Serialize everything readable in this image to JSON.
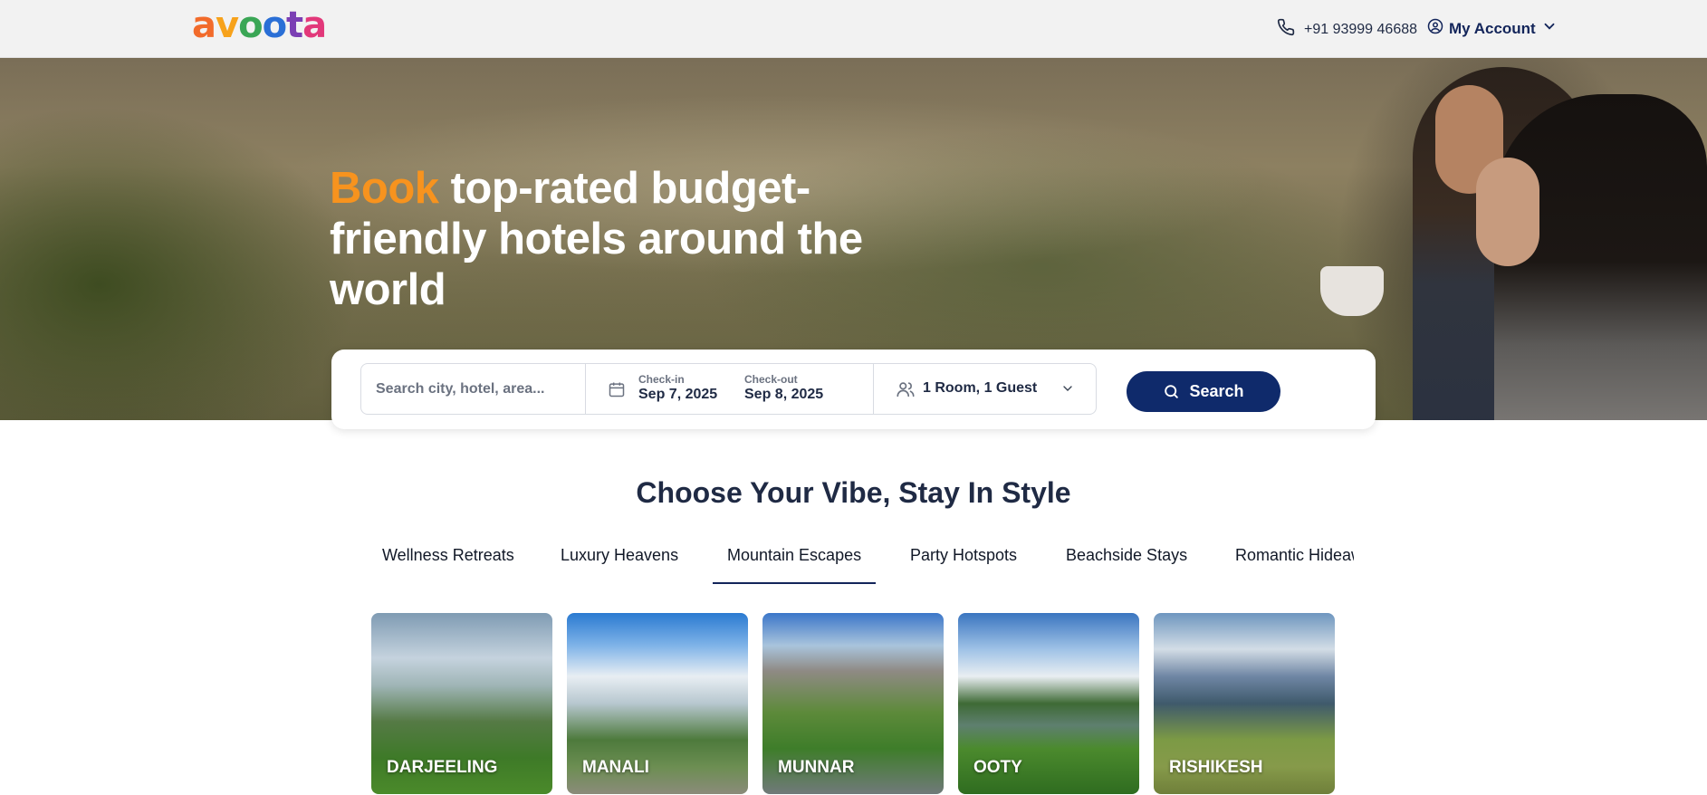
{
  "header": {
    "logo_letters": [
      {
        "char": "a",
        "color": "#f26b2b"
      },
      {
        "char": "v",
        "color": "#f7a21b"
      },
      {
        "char": "o",
        "color": "#3aa655"
      },
      {
        "char": "o",
        "color": "#2a6fd6"
      },
      {
        "char": "t",
        "color": "#7b3fb4"
      },
      {
        "char": "a",
        "color": "#e2387a"
      }
    ],
    "phone": "+91 93999 46688",
    "account_label": "My Account"
  },
  "hero": {
    "headline_accent": "Book",
    "headline_rest": " top-rated budget-friendly hotels around the world"
  },
  "search": {
    "placeholder": "Search city, hotel, area...",
    "checkin_label": "Check-in",
    "checkin_value": "Sep 7, 2025",
    "checkout_label": "Check-out",
    "checkout_value": "Sep 8, 2025",
    "guests": "1 Room, 1 Guest",
    "button_label": "Search"
  },
  "section": {
    "title": "Choose Your Vibe, Stay In Style",
    "tabs": [
      {
        "label": "Wellness Retreats"
      },
      {
        "label": "Luxury Heavens"
      },
      {
        "label": "Mountain Escapes",
        "active": true
      },
      {
        "label": "Party Hotspots"
      },
      {
        "label": "Beachside Stays"
      },
      {
        "label": "Romantic Hideaways"
      }
    ],
    "destinations": [
      {
        "label": "DARJEELING"
      },
      {
        "label": "MANALI"
      },
      {
        "label": "MUNNAR"
      },
      {
        "label": "OOTY"
      },
      {
        "label": "RISHIKESH"
      }
    ]
  },
  "colors": {
    "accent": "#f7931e",
    "brand_navy": "#0f2a6b"
  }
}
